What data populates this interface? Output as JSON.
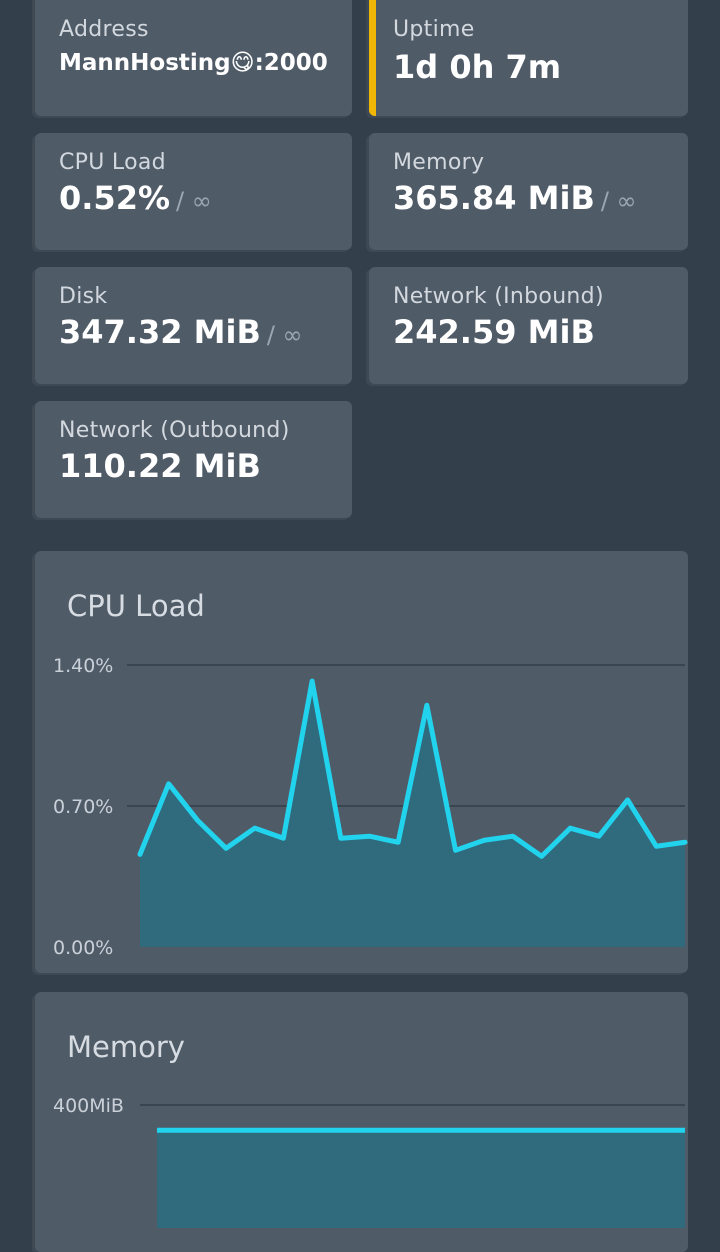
{
  "stats": {
    "address": {
      "label": "Address",
      "value": "MannHosting😋:2000"
    },
    "uptime": {
      "label": "Uptime",
      "value": "1d 0h 7m",
      "accent_color": "#f2b705"
    },
    "cpu_load": {
      "label": "CPU Load",
      "value": "0.52%",
      "limit": "/ ∞"
    },
    "memory": {
      "label": "Memory",
      "value": "365.84 MiB",
      "limit": "/ ∞"
    },
    "disk": {
      "label": "Disk",
      "value": "347.32 MiB",
      "limit": "/ ∞"
    },
    "network_in": {
      "label": "Network (Inbound)",
      "value": "242.59 MiB"
    },
    "network_out": {
      "label": "Network (Outbound)",
      "value": "110.22 MiB"
    }
  },
  "charts": {
    "cpu": {
      "title": "CPU Load"
    },
    "memory": {
      "title": "Memory"
    }
  },
  "colors": {
    "line": "#22d3ee",
    "fill": "#2f6a7d",
    "card": "#505b68",
    "background": "#333f4b"
  },
  "chart_data": [
    {
      "type": "area",
      "title": "CPU Load",
      "y_unit": "%",
      "ylim": [
        0,
        1.4
      ],
      "y_ticks": [
        "0.00%",
        "0.70%",
        "1.40%"
      ],
      "grid": true,
      "values": [
        0.46,
        0.81,
        0.63,
        0.49,
        0.59,
        0.54,
        1.32,
        0.54,
        0.55,
        0.52,
        1.2,
        0.48,
        0.53,
        0.55,
        0.45,
        0.59,
        0.55,
        0.73,
        0.5,
        0.52
      ]
    },
    {
      "type": "area",
      "title": "Memory",
      "y_unit": "MiB",
      "y_ticks": [
        "400MiB"
      ],
      "grid": true,
      "values": [
        365.84,
        365.84
      ]
    }
  ]
}
